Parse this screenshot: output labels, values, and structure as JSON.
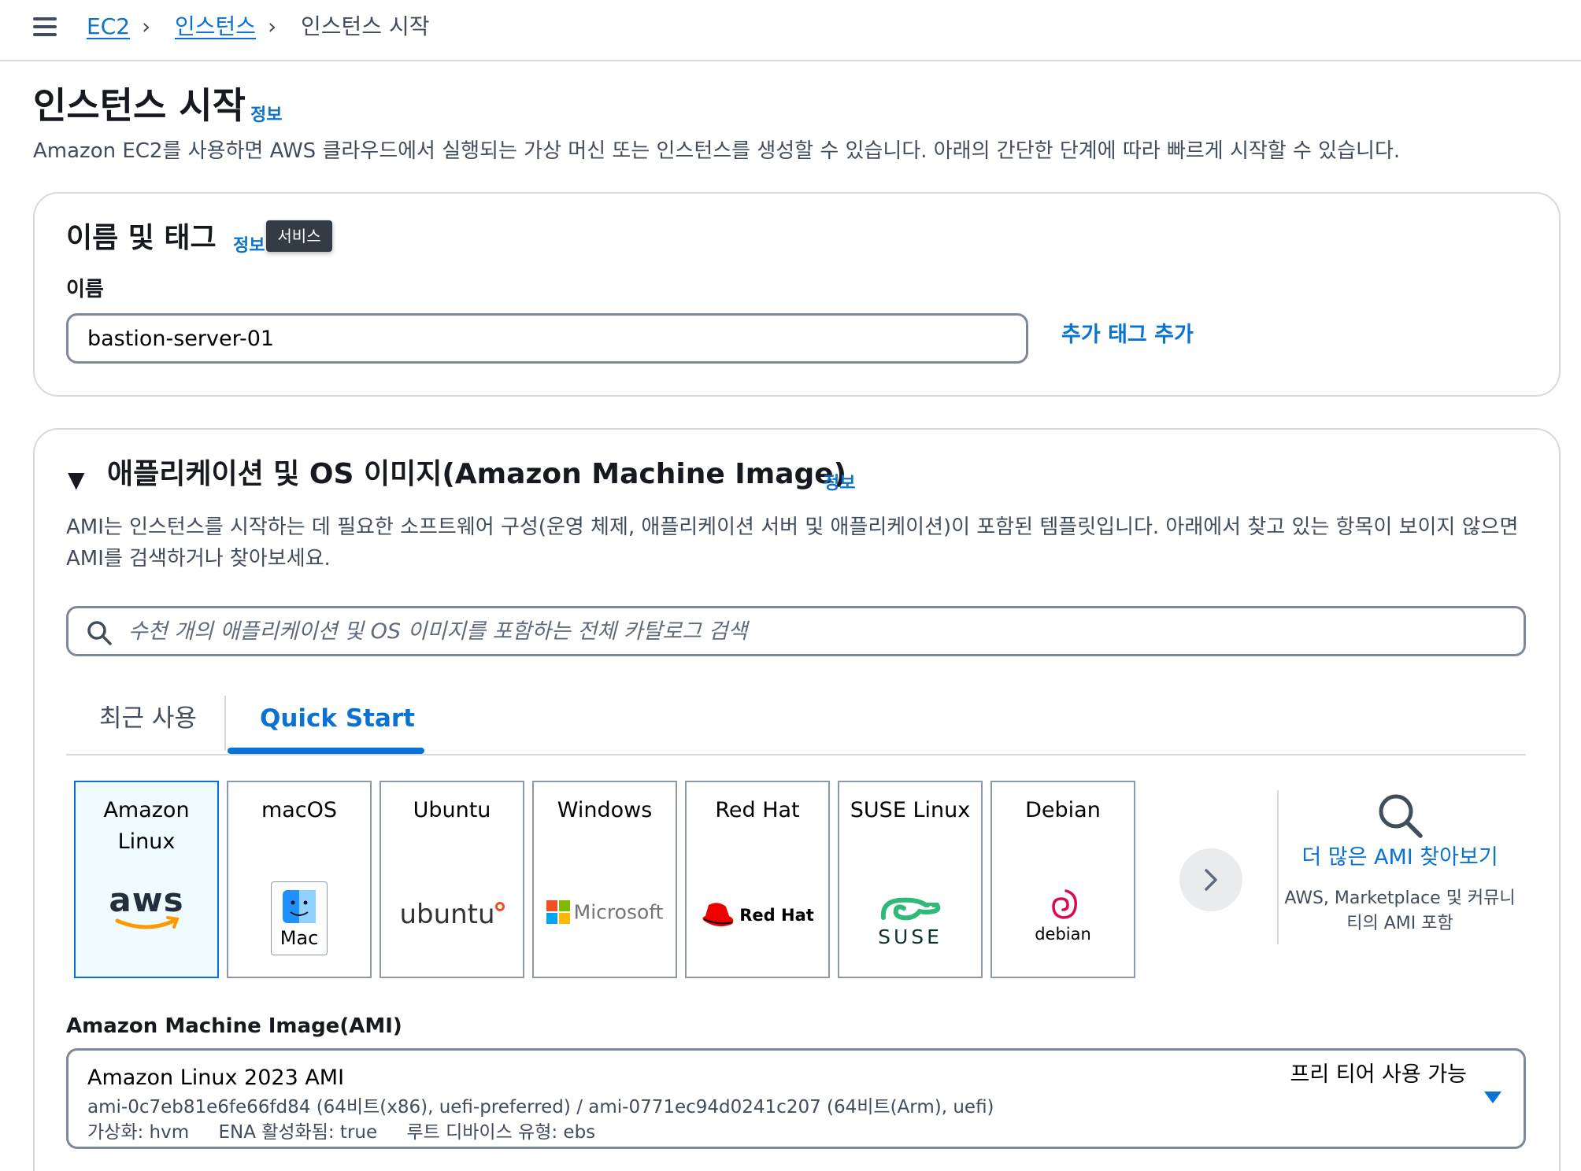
{
  "breadcrumb": {
    "items": [
      "EC2",
      "인스턴스",
      "인스턴스 시작"
    ]
  },
  "page": {
    "title": "인스턴스 시작",
    "info": "정보",
    "description": "Amazon EC2를 사용하면 AWS 클라우드에서 실행되는 가상 머신 또는 인스턴스를 생성할 수 있습니다. 아래의 간단한 단계에 따라 빠르게 시작할 수 있습니다."
  },
  "name_tags": {
    "title": "이름 및 태그",
    "info": "정보",
    "tooltip": "서비스",
    "name_label": "이름",
    "name_value": "bastion-server-01",
    "add_tags": "추가 태그 추가"
  },
  "ami_section": {
    "title": "애플리케이션 및 OS 이미지(Amazon Machine Image)",
    "info": "정보",
    "description": "AMI는 인스턴스를 시작하는 데 필요한 소프트웨어 구성(운영 체제, 애플리케이션 서버 및 애플리케이션)이 포함된 템플릿입니다. 아래에서 찾고 있는 항목이 보이지 않으면 AMI를 검색하거나 찾아보세요.",
    "search_placeholder": "수천 개의 애플리케이션 및 OS 이미지를 포함하는 전체 카탈로그 검색",
    "tabs": [
      {
        "label": "최근 사용",
        "active": false
      },
      {
        "label": "Quick Start",
        "active": true
      }
    ],
    "os_tiles": [
      {
        "label": "Amazon Linux",
        "logo": "aws",
        "selected": true
      },
      {
        "label": "macOS",
        "logo": "Mac",
        "selected": false
      },
      {
        "label": "Ubuntu",
        "logo": "ubuntu",
        "selected": false
      },
      {
        "label": "Windows",
        "logo": "Microsoft",
        "selected": false
      },
      {
        "label": "Red Hat",
        "logo": "Red Hat",
        "selected": false
      },
      {
        "label": "SUSE Linux",
        "logo": "SUSE",
        "selected": false
      },
      {
        "label": "Debian",
        "logo": "debian",
        "selected": false
      }
    ],
    "browse_more": "더 많은 AMI 찾아보기",
    "browse_more_sub": "AWS, Marketplace 및 커뮤니티의 AMI 포함",
    "ami_label": "Amazon Machine Image(AMI)",
    "selected_ami": {
      "name": "Amazon Linux 2023 AMI",
      "free_tier": "프리 티어 사용 가능",
      "ids": "ami-0c7eb81e6fe66fd84 (64비트(x86), uefi-preferred) / ami-0771ec94d0241c207 (64비트(Arm), uefi)",
      "virtualization": "가상화: hvm",
      "ena": "ENA 활성화됨: true",
      "root_device": "루트 디바이스 유형: ebs"
    }
  },
  "colors": {
    "link": "#0972d3",
    "border": "#d5dbdb",
    "input_border": "#7d8998",
    "selected_tile_bg": "#f0fbff"
  }
}
